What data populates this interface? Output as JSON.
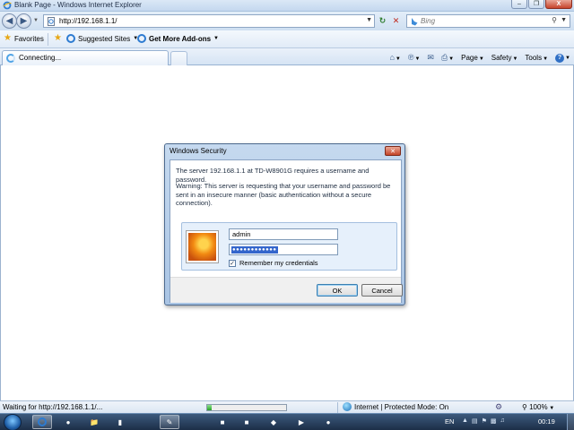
{
  "window": {
    "title": "Blank Page - Windows Internet Explorer",
    "minimize_glyph": "–",
    "maximize_glyph": "❐",
    "close_glyph": "X"
  },
  "address_bar": {
    "url": "http://192.168.1.1/",
    "search_placeholder": "Bing"
  },
  "favorites_bar": {
    "favorites_label": "Favorites",
    "suggested_sites_label": "Suggested Sites",
    "get_more_addons_label": "Get More Add-ons"
  },
  "tabs": [
    {
      "label": "Connecting...",
      "loading": true
    }
  ],
  "command_bar": {
    "page_label": "Page",
    "safety_label": "Safety",
    "tools_label": "Tools"
  },
  "dialog": {
    "title": "Windows Security",
    "message": "The server 192.168.1.1 at TD-W8901G requires a username and password.",
    "warning": "Warning: This server is requesting that your username and password be sent in an insecure manner (basic authentication without a secure connection).",
    "username_value": "admin",
    "password_mask": "●●●●●●●●●●●●",
    "remember_label": "Remember my credentials",
    "remember_checked": true,
    "ok_label": "OK",
    "cancel_label": "Cancel"
  },
  "status_bar": {
    "status_text": "Waiting for http://192.168.1.1/...",
    "progress": 0.06,
    "zone_text": "Internet | Protected Mode: On",
    "zoom": "100%"
  },
  "taskbar": {
    "language": "EN",
    "clock": "00:19",
    "apps": [
      "ie",
      "firefox",
      "folder",
      "cmd",
      "paint",
      "photoshop",
      "flash",
      "app-7",
      "app-8",
      "app-9"
    ]
  },
  "colors": {
    "accent": "#3365cc",
    "close_red": "#c44428",
    "taskbar": "#1c2e47"
  }
}
